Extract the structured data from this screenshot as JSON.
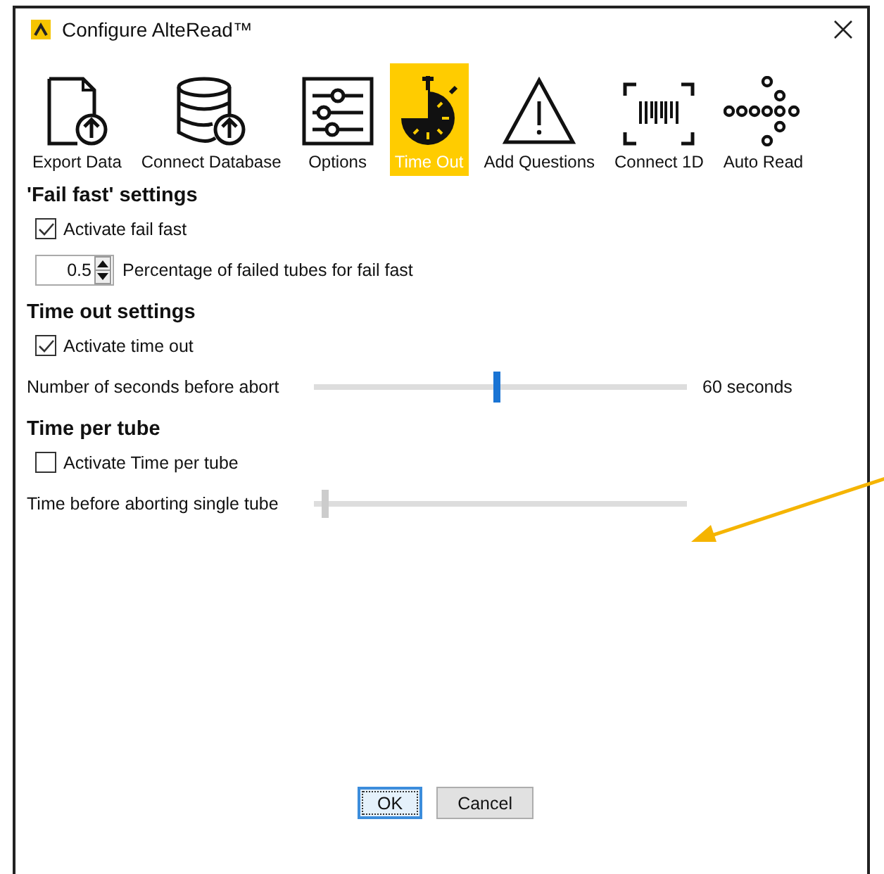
{
  "window": {
    "title": "Configure AlteRead™"
  },
  "toolbar": [
    {
      "label": "Export Data",
      "kind": "export",
      "selected": false
    },
    {
      "label": "Connect Database",
      "kind": "database",
      "selected": false
    },
    {
      "label": "Options",
      "kind": "options",
      "selected": false
    },
    {
      "label": "Time Out",
      "kind": "timer",
      "selected": true
    },
    {
      "label": "Add Questions",
      "kind": "warning",
      "selected": false
    },
    {
      "label": "Connect 1D",
      "kind": "barcode",
      "selected": false
    },
    {
      "label": "Auto Read",
      "kind": "dots",
      "selected": false
    }
  ],
  "sections": [
    {
      "heading": "'Fail fast' settings",
      "rows": [
        {
          "kind": "checkbox",
          "label": "Activate fail fast",
          "checked": true
        },
        {
          "kind": "spinner",
          "value": "0.5",
          "label": "Percentage of failed tubes for fail fast"
        }
      ]
    },
    {
      "heading": "Time out settings",
      "rows": [
        {
          "kind": "checkbox",
          "label": "Activate time out",
          "checked": true
        },
        {
          "kind": "slider",
          "label": "Number of seconds before abort",
          "level": 0.49,
          "disabled": false,
          "reading": "60 seconds"
        }
      ]
    },
    {
      "heading": "Time per tube",
      "rows": [
        {
          "kind": "checkbox",
          "label": "Activate Time per tube",
          "checked": false
        },
        {
          "kind": "slider",
          "label": "Time before aborting single tube",
          "level": 0.03,
          "disabled": true
        }
      ]
    }
  ],
  "buttons": [
    {
      "label": "OK",
      "selected": true
    },
    {
      "label": "Cancel",
      "selected": false
    }
  ]
}
